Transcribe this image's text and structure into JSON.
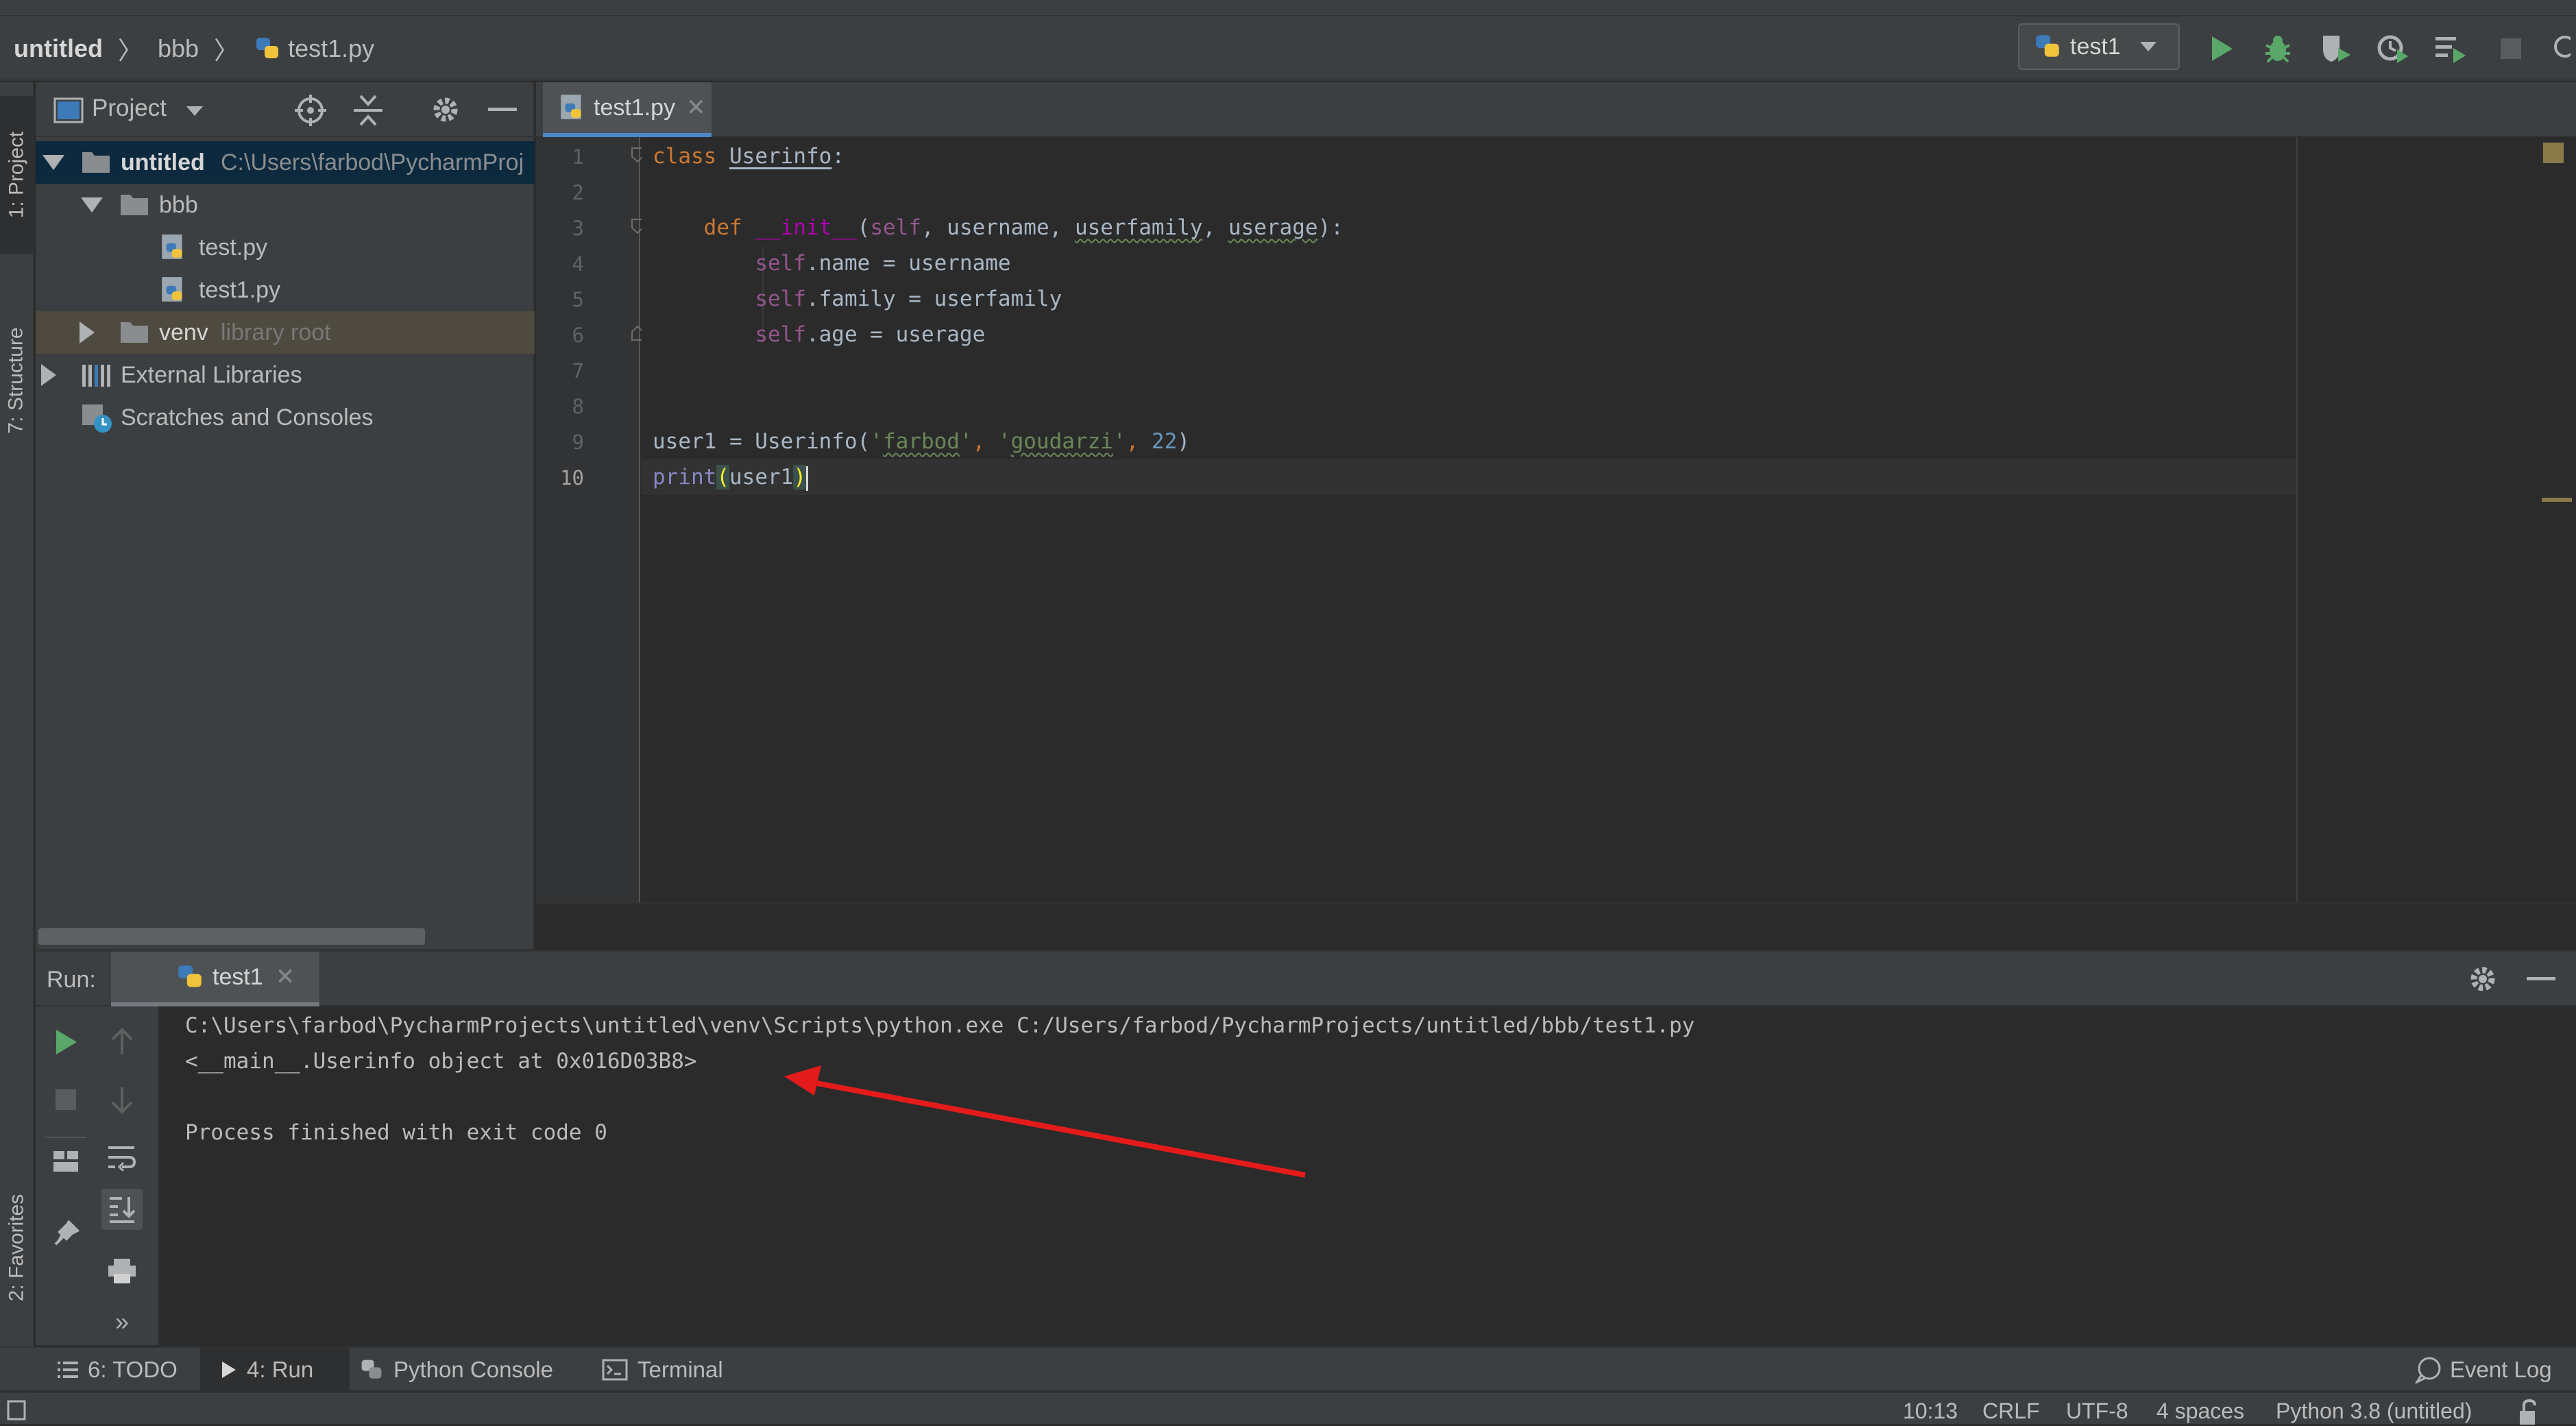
{
  "navbar": {
    "breadcrumb": [
      "untitled",
      "bbb",
      "test1.py"
    ],
    "run_config": "test1"
  },
  "left_strip": {
    "tabs": [
      "1: Project",
      "7: Structure",
      "2: Favorites"
    ]
  },
  "project_panel": {
    "title": "Project",
    "tree": [
      {
        "label": "untitled",
        "hint": "C:\\Users\\farbod\\PycharmProj"
      },
      {
        "label": "bbb"
      },
      {
        "label": "test.py"
      },
      {
        "label": "test1.py"
      },
      {
        "label": "venv",
        "hint": "library root"
      },
      {
        "label": "External Libraries"
      },
      {
        "label": "Scratches and Consoles"
      }
    ]
  },
  "editor": {
    "tab_label": "test1.py",
    "line_numbers": [
      "1",
      "2",
      "3",
      "4",
      "5",
      "6",
      "7",
      "8",
      "9",
      "10"
    ],
    "tokens": {
      "l1_kw": "class",
      "l1_name": "Userinfo",
      "l1_colon": ":",
      "l3_kw": "def",
      "l3_fn": "__init__",
      "l3_open": "(",
      "l3_self": "self",
      "l3_rest1": ", username, ",
      "l3_uf": "userfamily",
      "l3_comma": ", ",
      "l3_ua": "userage",
      "l3_close": "):",
      "l4_self": "self",
      "l4_rest": ".name = username",
      "l5_self": "self",
      "l5_rest": ".family = userfamily",
      "l6_self": "self",
      "l6_rest": ".age = userage",
      "l9_a": "user1 = Userinfo(",
      "l9_q1": "'",
      "l9_s1": "farbod",
      "l9_q2": "'",
      "l9_c1": ", ",
      "l9_q3": "'",
      "l9_s2": "goudarzi",
      "l9_q4": "'",
      "l9_c2": ", ",
      "l9_n": "22",
      "l9_b": ")",
      "l10_fn": "print",
      "l10_open": "(",
      "l10_arg": "user1",
      "l10_close": ")"
    }
  },
  "run_panel": {
    "label": "Run:",
    "tab": "test1",
    "output": [
      "C:\\Users\\farbod\\PycharmProjects\\untitled\\venv\\Scripts\\python.exe C:/Users/farbod/PycharmProjects/untitled/bbb/test1.py",
      "<__main__.Userinfo object at 0x016D03B8>",
      "",
      "Process finished with exit code 0"
    ],
    "more": "»"
  },
  "bottom_tabs": {
    "todo": "6: TODO",
    "run": "4: Run",
    "python_console": "Python Console",
    "terminal": "Terminal",
    "event_log": "Event Log"
  },
  "status_bar": {
    "position": "10:13",
    "line_sep": "CRLF",
    "encoding": "UTF-8",
    "indent": "4 spaces",
    "interpreter": "Python 3.8 (untitled)"
  },
  "colors": {
    "annotation_arrow": "#e31b1b",
    "run_green": "#59a869",
    "tab_underline": "#4a88c7"
  }
}
